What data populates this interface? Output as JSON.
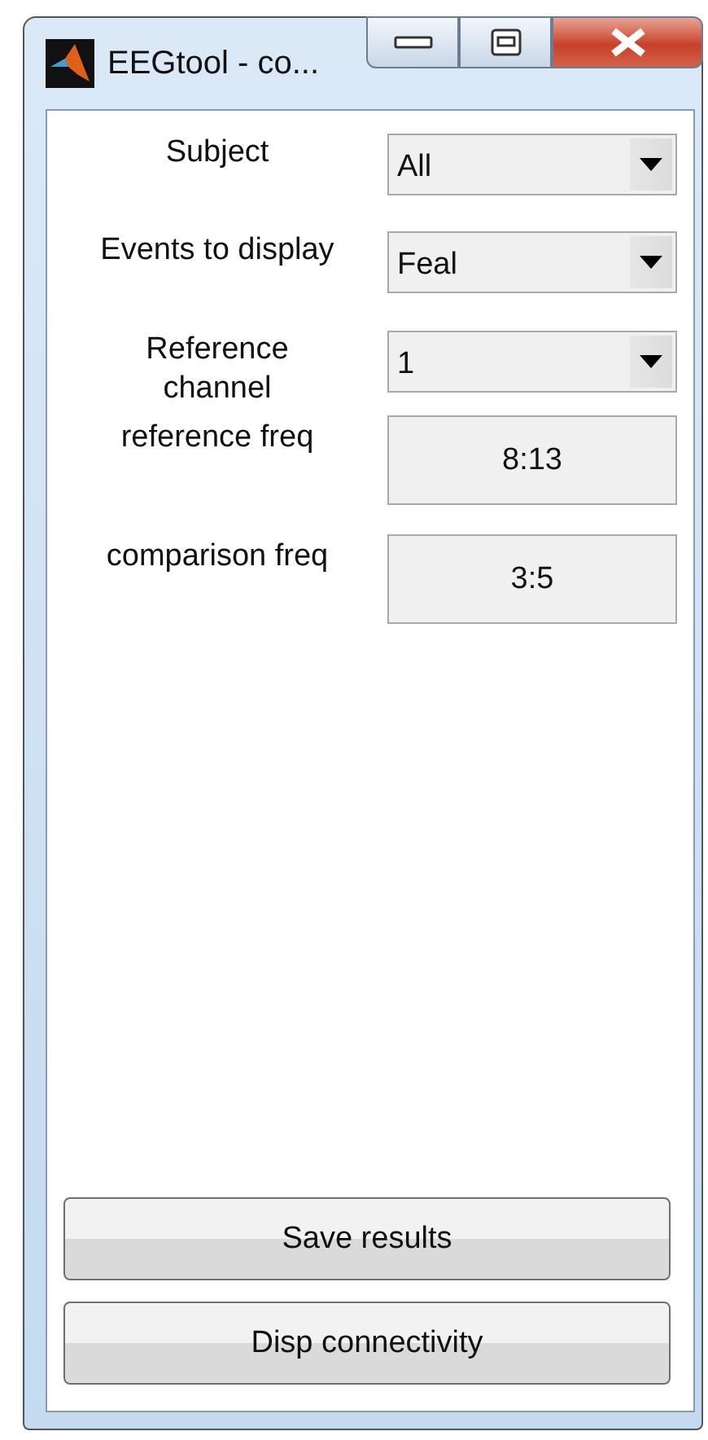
{
  "window": {
    "title": "EEGtool - co..."
  },
  "fields": [
    {
      "label": "Subject",
      "kind": "dropdown",
      "value": "All"
    },
    {
      "label": "Events to display",
      "kind": "dropdown",
      "value": "Feal"
    },
    {
      "label": "Reference channel",
      "kind": "dropdown",
      "value": "1"
    },
    {
      "label": "reference freq",
      "kind": "edit",
      "value": "8:13"
    },
    {
      "label": "comparison freq",
      "kind": "edit",
      "value": "3:5"
    }
  ],
  "buttons": [
    "Save results",
    "Disp connectivity"
  ]
}
